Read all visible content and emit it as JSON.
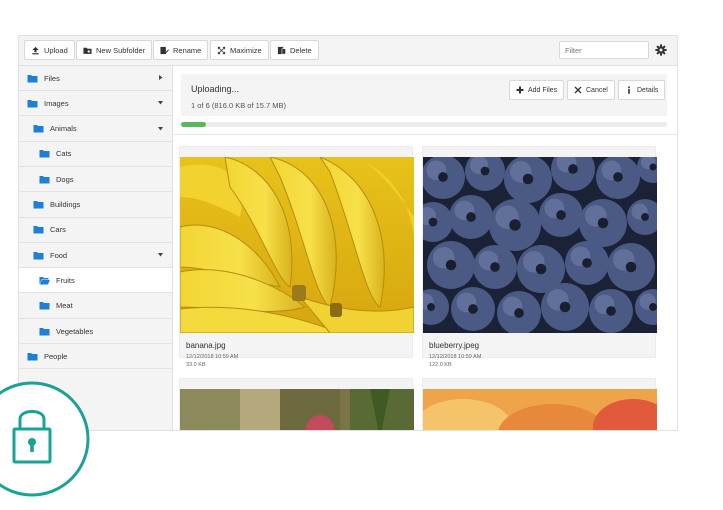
{
  "toolbar": {
    "buttons": [
      {
        "label": "Upload",
        "icon": "upload-icon"
      },
      {
        "label": "New Subfolder",
        "icon": "new-folder-icon"
      },
      {
        "label": "Rename",
        "icon": "rename-icon"
      },
      {
        "label": "Maximize",
        "icon": "maximize-icon"
      },
      {
        "label": "Delete",
        "icon": "delete-icon"
      }
    ],
    "filter_placeholder": "Filter",
    "settings_icon": "gear-icon"
  },
  "sidebar": {
    "items": [
      {
        "label": "Files",
        "level": 0,
        "expander": "collapsed"
      },
      {
        "label": "Images",
        "level": 0,
        "expander": "expanded"
      },
      {
        "label": "Animals",
        "level": 1,
        "expander": "expanded"
      },
      {
        "label": "Cats",
        "level": 2
      },
      {
        "label": "Dogs",
        "level": 2
      },
      {
        "label": "Buildings",
        "level": 1
      },
      {
        "label": "Cars",
        "level": 1
      },
      {
        "label": "Food",
        "level": 1,
        "expander": "expanded"
      },
      {
        "label": "Fruits",
        "level": 2,
        "selected": true
      },
      {
        "label": "Meat",
        "level": 2
      },
      {
        "label": "Vegetables",
        "level": 2
      },
      {
        "label": "People",
        "level": 0
      }
    ]
  },
  "upload": {
    "title": "Uploading...",
    "status": "1 of 6 (816.0 KB of 15.7 MB)",
    "progress_fraction": 0.052,
    "buttons": [
      {
        "label": "Add Files",
        "icon": "plus-icon"
      },
      {
        "label": "Cancel",
        "icon": "close-icon"
      },
      {
        "label": "Details",
        "icon": "info-icon"
      }
    ]
  },
  "files": [
    {
      "name": "banana.jpg",
      "date": "12/12/2018 10:59 AM",
      "size": "33.0 KB"
    },
    {
      "name": "blueberry.jpeg",
      "date": "12/12/2018 10:59 AM",
      "size": "122.0 KB"
    }
  ],
  "colors": {
    "accent_blue": "#1e7fd8",
    "progress_green": "#5cb85c",
    "lock_teal": "#1aa394"
  }
}
